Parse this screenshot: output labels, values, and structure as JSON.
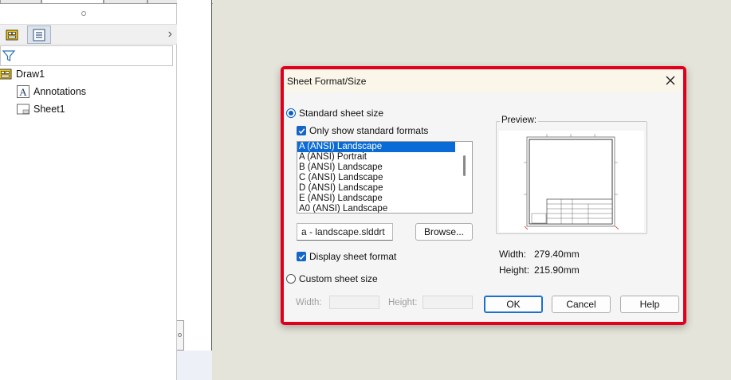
{
  "tree": {
    "root": "Draw1",
    "children": [
      "Annotations",
      "Sheet1"
    ]
  },
  "dialog": {
    "title": "Sheet Format/Size",
    "standard_size_label": "Standard sheet size",
    "only_standard_label": "Only show standard formats",
    "formats": [
      "A (ANSI) Landscape",
      "A (ANSI) Portrait",
      "B (ANSI) Landscape",
      "C (ANSI) Landscape",
      "D (ANSI) Landscape",
      "E (ANSI) Landscape",
      "A0 (ANSI) Landscape"
    ],
    "selected_format": "A (ANSI) Landscape",
    "format_file": "a - landscape.slddrt",
    "browse_label": "Browse...",
    "display_format_label": "Display sheet format",
    "custom_size_label": "Custom sheet size",
    "width_label": "Width:",
    "height_label": "Height:",
    "width_value": "",
    "height_value": "",
    "preview_label": "Preview:",
    "preview_width_label": "Width:",
    "preview_width_value": "279.40mm",
    "preview_height_label": "Height:",
    "preview_height_value": "215.90mm",
    "ok_label": "OK",
    "cancel_label": "Cancel",
    "help_label": "Help"
  },
  "colors": {
    "accent": "#0a6bd6",
    "highlight_border": "#e0001b",
    "title_bar": "#fbf6ea"
  },
  "icons": [
    "drawing-icon",
    "property-list-icon",
    "chevron-right-icon",
    "filter-icon",
    "annotations-icon",
    "sheet-icon",
    "close-icon"
  ]
}
